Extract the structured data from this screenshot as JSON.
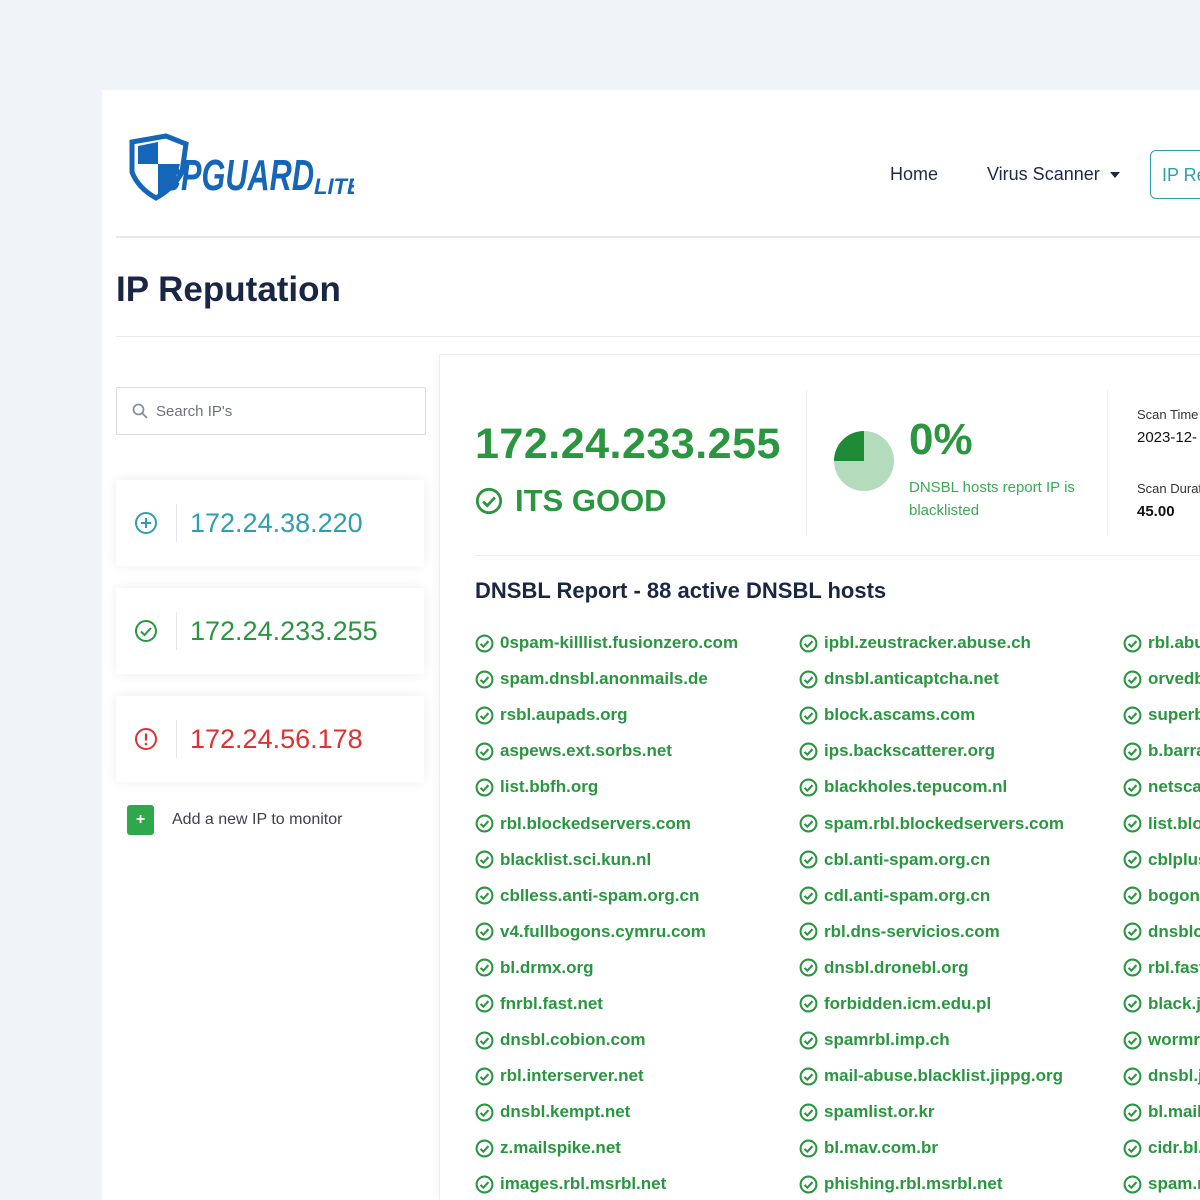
{
  "header": {
    "logo_text": "cPGuard LITE",
    "nav": {
      "home": "Home",
      "virus_scanner": "Virus Scanner",
      "ip_reputation": "IP Reputation"
    }
  },
  "page_title": "IP Reputation",
  "sidebar": {
    "search_placeholder": "Search IP's",
    "ips": [
      {
        "address": "172.24.38.220",
        "status": "pending",
        "color": "#2d9fb0"
      },
      {
        "address": "172.24.233.255",
        "status": "good",
        "color": "#2a9640"
      },
      {
        "address": "172.24.56.178",
        "status": "bad",
        "color": "#e03131"
      }
    ],
    "add_label": "Add a new IP to monitor"
  },
  "result": {
    "ip": "172.24.233.255",
    "status_text": "ITS GOOD",
    "percent": "0%",
    "percent_desc": "DNSBL hosts report IP is blacklisted",
    "scan_time_label": "Scan Time",
    "scan_time_value": "2023-12-",
    "scan_duration_label": "Scan Duration",
    "scan_duration_value": "45.00"
  },
  "report": {
    "title": "DNSBL Report - 88 active DNSBL hosts",
    "columns": [
      [
        "0spam-killlist.fusionzero.com",
        "spam.dnsbl.anonmails.de",
        "rsbl.aupads.org",
        "aspews.ext.sorbs.net",
        "list.bbfh.org",
        "rbl.blockedservers.com",
        "blacklist.sci.kun.nl",
        "cblless.anti-spam.org.cn",
        "v4.fullbogons.cymru.com",
        "bl.drmx.org",
        "fnrbl.fast.net",
        "dnsbl.cobion.com",
        "rbl.interserver.net",
        "dnsbl.kempt.net",
        "z.mailspike.net",
        "images.rbl.msrbl.net"
      ],
      [
        "ipbl.zeustracker.abuse.ch",
        "dnsbl.anticaptcha.net",
        "block.ascams.com",
        "ips.backscatterer.org",
        "blackholes.tepucom.nl",
        "spam.rbl.blockedservers.com",
        "cbl.anti-spam.org.cn",
        "cdl.anti-spam.org.cn",
        "rbl.dns-servicios.com",
        "dnsbl.dronebl.org",
        "forbidden.icm.edu.pl",
        "spamrbl.imp.ch",
        "mail-abuse.blacklist.jippg.org",
        "spamlist.or.kr",
        "bl.mav.com.br",
        "phishing.rbl.msrbl.net"
      ],
      [
        "rbl.abu",
        "orvedb",
        "superbl",
        "b.barra",
        "netscan",
        "list.blog",
        "cblplus",
        "bogons",
        "dnsblch",
        "rbl.fastl",
        "black.ju",
        "wormrb",
        "dnsbl.ju",
        "bl.mails",
        "cidr.bl.",
        "spam.rl"
      ]
    ]
  }
}
